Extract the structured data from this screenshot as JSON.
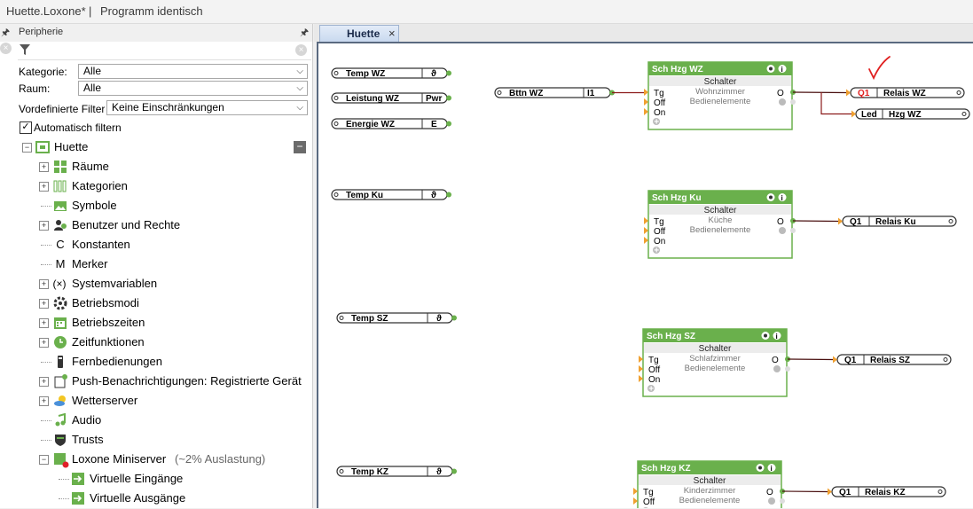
{
  "window": {
    "title": "Huette.Loxone*",
    "separator": "|",
    "status": "Programm identisch"
  },
  "left_panel": {
    "title": "Peripherie",
    "filters": {
      "kategorie_label": "Kategorie:",
      "kategorie_value": "Alle",
      "raum_label": "Raum:",
      "raum_value": "Alle",
      "vordefiniert_label": "Vordefinierte Filter",
      "vordefiniert_value": "Keine Einschränkungen",
      "auto_filter_label": "Automatisch filtern",
      "auto_filter_checked": true
    },
    "tree": {
      "root": "Huette",
      "items": [
        {
          "label": "Räume",
          "icon": "grid-icon"
        },
        {
          "label": "Kategorien",
          "icon": "bars-icon"
        },
        {
          "label": "Symbole",
          "icon": "image-icon"
        },
        {
          "label": "Benutzer und Rechte",
          "icon": "users-icon"
        },
        {
          "label": "Konstanten",
          "icon": "c-icon",
          "glyph": "C"
        },
        {
          "label": "Merker",
          "icon": "m-icon",
          "glyph": "M"
        },
        {
          "label": "Systemvariablen",
          "icon": "variable-icon",
          "glyph": "(×)"
        },
        {
          "label": "Betriebsmodi",
          "icon": "gear-icon"
        },
        {
          "label": "Betriebszeiten",
          "icon": "calendar-icon"
        },
        {
          "label": "Zeitfunktionen",
          "icon": "clock-icon"
        },
        {
          "label": "Fernbedienungen",
          "icon": "remote-icon"
        },
        {
          "label": "Push-Benachrichtigungen: Registrierte Gerät",
          "icon": "push-icon"
        },
        {
          "label": "Wetterserver",
          "icon": "weather-icon"
        },
        {
          "label": "Audio",
          "icon": "music-icon"
        },
        {
          "label": "Trusts",
          "icon": "shield-icon"
        },
        {
          "label": "Loxone Miniserver",
          "suffix": "(~2% Auslastung)",
          "icon": "miniserver-icon"
        },
        {
          "label": "Virtuelle Eingänge",
          "icon": "virtual-in-icon"
        },
        {
          "label": "Virtuelle Ausgänge",
          "icon": "virtual-out-icon"
        }
      ]
    }
  },
  "tabs": [
    {
      "label": "Huette",
      "close": "×"
    }
  ],
  "canvas": {
    "inputs": [
      {
        "name": "Temp WZ",
        "tag": "ϑ"
      },
      {
        "name": "Leistung WZ",
        "tag": "Pwr"
      },
      {
        "name": "Energie WZ",
        "tag": "E"
      },
      {
        "name": "Temp Ku",
        "tag": "ϑ"
      },
      {
        "name": "Temp SZ",
        "tag": "ϑ"
      },
      {
        "name": "Temp KZ",
        "tag": "ϑ"
      },
      {
        "name": "Bttn WZ",
        "tag": "I1"
      }
    ],
    "blocks": [
      {
        "title": "Sch Hzg WZ",
        "type": "Schalter",
        "room": "Wohnzimmer",
        "cat": "Bedienelemente",
        "in": [
          "Tg",
          "Off",
          "On"
        ],
        "out": "O"
      },
      {
        "title": "Sch Hzg Ku",
        "type": "Schalter",
        "room": "Küche",
        "cat": "Bedienelemente",
        "in": [
          "Tg",
          "Off",
          "On"
        ],
        "out": "O"
      },
      {
        "title": "Sch Hzg SZ",
        "type": "Schalter",
        "room": "Schlafzimmer",
        "cat": "Bedienelemente",
        "in": [
          "Tg",
          "Off",
          "On"
        ],
        "out": "O"
      },
      {
        "title": "Sch Hzg KZ",
        "type": "Schalter",
        "room": "Kinderzimmer",
        "cat": "Bedienelemente",
        "in": [
          "Tg",
          "Off"
        ],
        "out": "O"
      }
    ],
    "outputs": [
      {
        "tag": "Q1",
        "name": "Relais WZ"
      },
      {
        "tag": "Led",
        "name": "Hzg WZ"
      },
      {
        "tag": "Q1",
        "name": "Relais Ku"
      },
      {
        "tag": "Q1",
        "name": "Relais SZ"
      },
      {
        "tag": "Q1",
        "name": "Relais KZ"
      }
    ],
    "colors": {
      "block_green": "#6ab04c",
      "wire_dark": "#4a1010",
      "wire_red": "#8b1a1a",
      "pin_orange": "#f0a030",
      "annotation_red": "#e02020"
    }
  }
}
